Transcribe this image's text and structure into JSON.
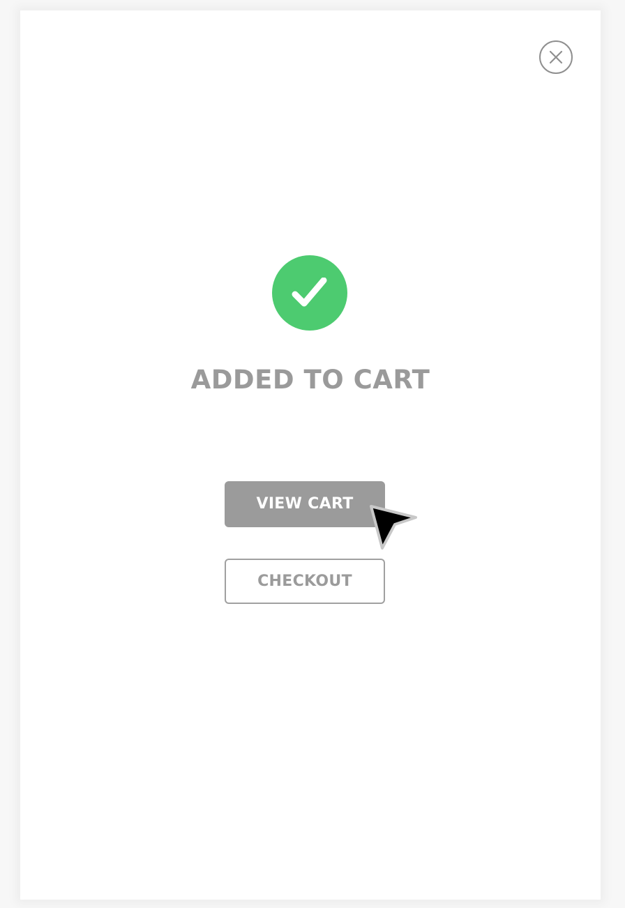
{
  "modal": {
    "close_icon": "close-icon",
    "success_icon": "check-circle-icon",
    "title": "ADDED TO CART",
    "view_cart_label": "VIEW CART",
    "checkout_label": "CHECKOUT",
    "colors": {
      "success": "#4dcb70",
      "primary_button": "#9b9b9b",
      "text_muted": "#9a9a9a",
      "outline": "#a0a0a0"
    }
  },
  "cursor": {
    "icon": "pointer-arrow-icon"
  }
}
